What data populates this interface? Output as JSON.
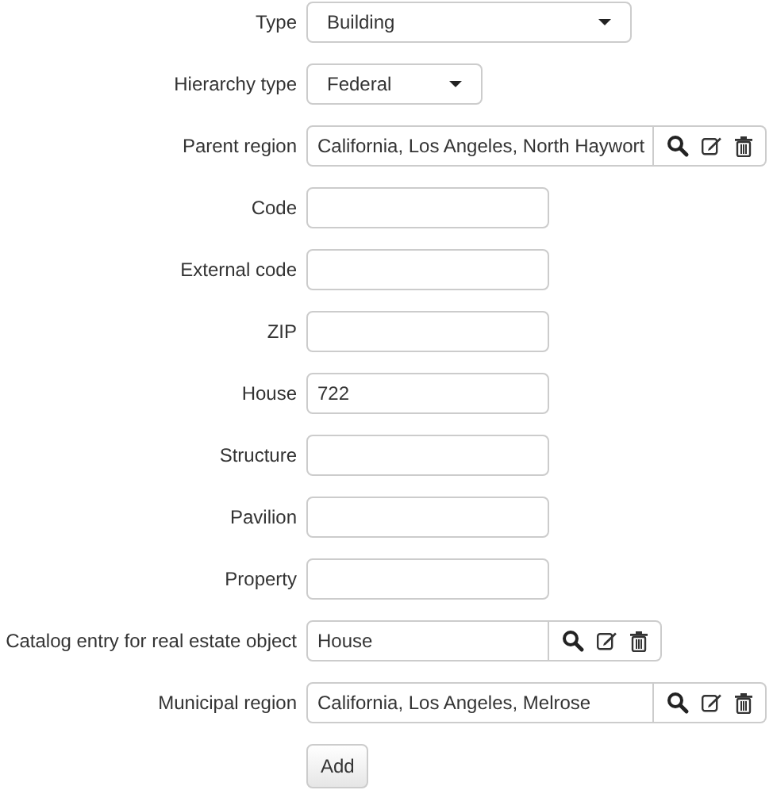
{
  "fields": [
    {
      "label": "Type",
      "kind": "select",
      "value": "Building"
    },
    {
      "label": "Hierarchy type",
      "kind": "select",
      "value": "Federal"
    },
    {
      "label": "Parent region",
      "kind": "lookup",
      "value": "California, Los Angeles, North Haywort"
    },
    {
      "label": "Code",
      "kind": "text"
    },
    {
      "label": "External code",
      "kind": "text"
    },
    {
      "label": "ZIP",
      "kind": "text"
    },
    {
      "label": "House",
      "kind": "text",
      "value": "722"
    },
    {
      "label": "Structure",
      "kind": "text"
    },
    {
      "label": "Pavilion",
      "kind": "text"
    },
    {
      "label": "Property",
      "kind": "text"
    },
    {
      "label": "Catalog entry for real estate object",
      "kind": "lookup",
      "value": "House"
    },
    {
      "label": "Municipal region",
      "kind": "lookup",
      "value": "California, Los Angeles, Melrose"
    }
  ],
  "submit": "Add"
}
